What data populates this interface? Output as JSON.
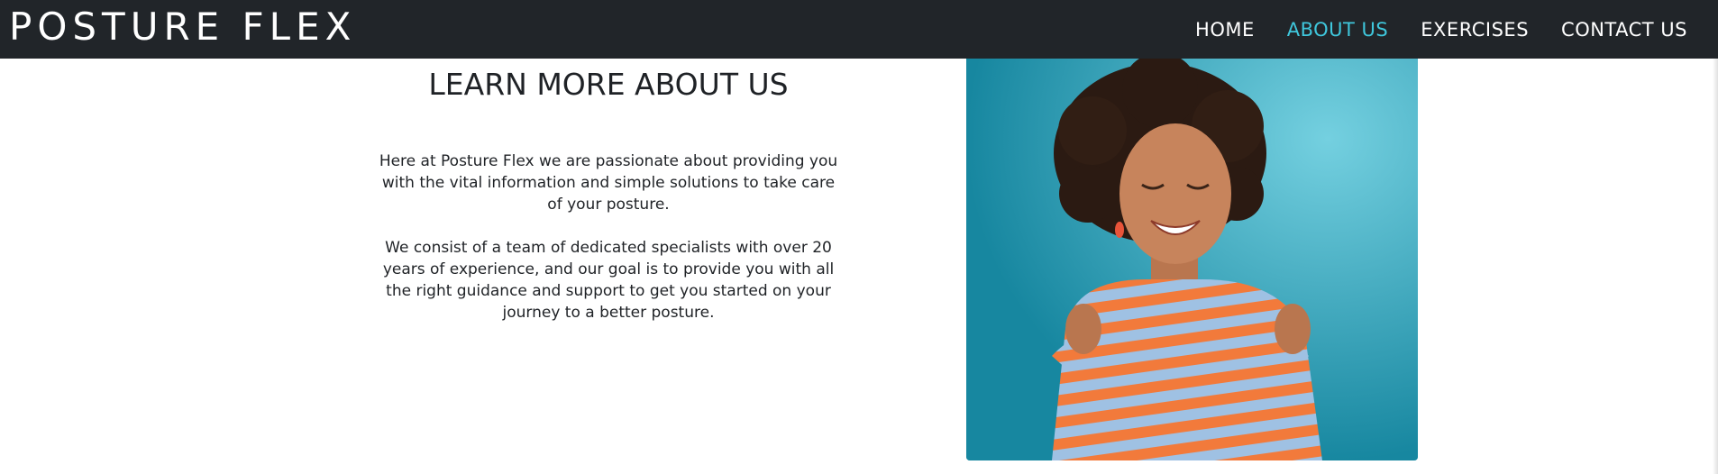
{
  "navbar": {
    "brand": "POSTURE FLEX",
    "links": [
      {
        "label": "HOME",
        "active": false
      },
      {
        "label": "ABOUT US",
        "active": true
      },
      {
        "label": "EXERCISES",
        "active": false
      },
      {
        "label": "CONTACT US",
        "active": false
      }
    ],
    "active_color": "#3fc7dc",
    "background": "#212529"
  },
  "about": {
    "heading": "LEARN MORE ABOUT US",
    "paragraphs": [
      "Here at Posture Flex we are passionate about providing you with the vital information and simple solutions to take care of your posture.",
      "We consist of a team of dedicated specialists with over 20 years of experience, and our goal is to provide you with all the right guidance and support to get you started on your journey to a better posture."
    ]
  },
  "image": {
    "alt": "woman hugging herself"
  }
}
